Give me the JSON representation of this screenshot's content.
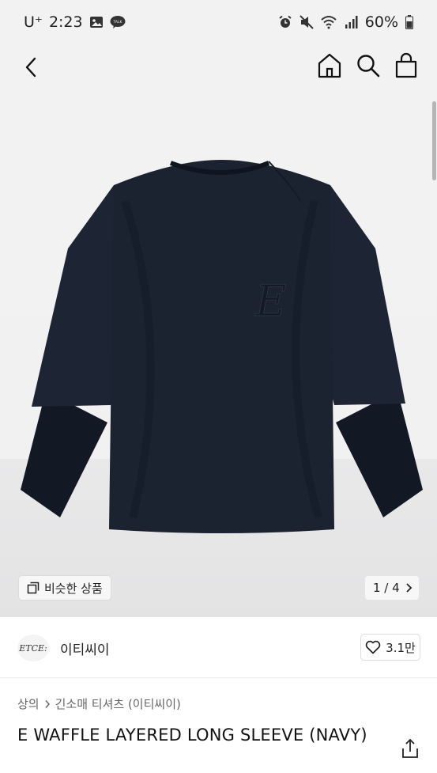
{
  "status_bar": {
    "carrier": "U⁺",
    "time": "2:23",
    "battery": "60%",
    "left_icons": [
      "gallery-icon",
      "kakaotalk-icon"
    ],
    "right_icons": [
      "alarm-icon",
      "mute-icon",
      "wifi-icon",
      "signal-icon",
      "battery-icon"
    ]
  },
  "nav": {
    "icons": [
      "back-icon",
      "home-icon",
      "search-icon",
      "shopping-bag-icon"
    ]
  },
  "hero": {
    "similar_label": "비슷한 상품",
    "pager_text": "1 / 4",
    "shirt_logo_letter": "E"
  },
  "brand": {
    "logo_text": "ETCE:",
    "name": "이티씨이",
    "like_count": "3.1만"
  },
  "breadcrumb": {
    "category": "상의",
    "subcategory": "긴소매 티셔츠 (이티씨이)"
  },
  "product": {
    "title": "E WAFFLE LAYERED LONG SLEEVE (NAVY)"
  },
  "colors": {
    "shirt_navy": "#1b2230",
    "background": "#f2f2f3"
  }
}
